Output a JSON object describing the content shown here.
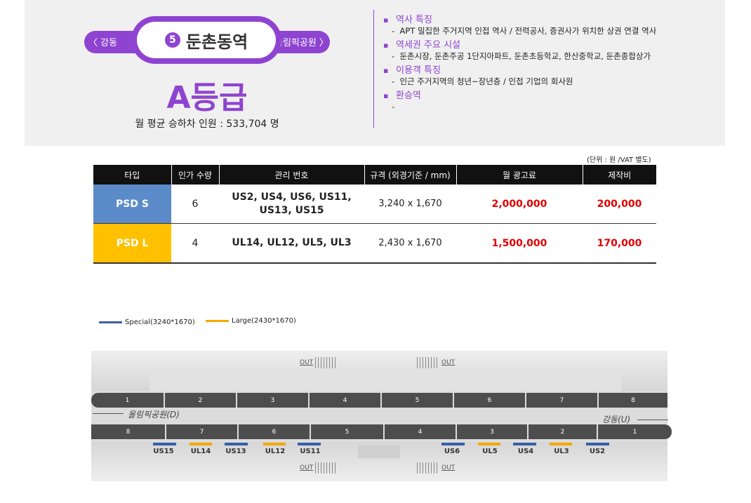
{
  "station": {
    "prev": "〈 강동",
    "next": "올림픽공원 〉",
    "number": "5",
    "name": "둔촌동역",
    "grade": "A등급",
    "ridership_label": "월 평균 승하차 인원 :",
    "ridership_value": "533,704 명"
  },
  "features": [
    {
      "title": "역사 특징",
      "desc": "APT  밀집한 주거지역 인접 역사 / 전력공사, 증권사가 위치한 상권 연결 역사"
    },
    {
      "title": "역세권 주요 시설",
      "desc": "둔촌시장,  둔촌주공 1단지아파트, 둔촌초등학교, 한산중학교, 둔촌종합상가"
    },
    {
      "title": "이용객 특징",
      "desc": "인근 주거지역의 청년~장년층 / 인접 기업의 회사원"
    },
    {
      "title": "환승역",
      "desc": ""
    }
  ],
  "bullet": "▪",
  "dash": "-",
  "table": {
    "unit": "(단위 : 원 /VAT 별도)",
    "headers": [
      "타입",
      "인가 수량",
      "관리 번호",
      "규격 (외경기준 / mm)",
      "월 광고료",
      "제작비"
    ],
    "rows": [
      {
        "type": "PSD S",
        "count": "6",
        "codes_1": "US2, US4, US6, US11,",
        "codes_2": "US13, US15",
        "spec": "3,240 x 1,670",
        "fee": "2,000,000",
        "production": "200,000",
        "color": "#5b8bc9"
      },
      {
        "type": "PSD L",
        "count": "4",
        "codes_1": "UL14, UL12, UL5, UL3",
        "codes_2": "",
        "spec": "2,430 x 1,670",
        "fee": "1,500,000",
        "production": "170,000",
        "color": "#ffc000"
      }
    ]
  },
  "legend": {
    "special": "Special(3240*1670)",
    "large": "Large(2430*1670)",
    "special_color": "#3a5fa8",
    "large_color": "#f5a800"
  },
  "map": {
    "top_cars": [
      "1",
      "2",
      "3",
      "4",
      "5",
      "6",
      "7",
      "8"
    ],
    "bottom_cars": [
      "8",
      "7",
      "6",
      "5",
      "4",
      "3",
      "2",
      "1"
    ],
    "dir_left": "올림픽공원(D)",
    "dir_right": "강동(U)",
    "exit_label": "OUT",
    "psds": [
      {
        "label": "US15",
        "kind": "S"
      },
      {
        "label": "UL14",
        "kind": "L"
      },
      {
        "label": "US13",
        "kind": "S"
      },
      {
        "label": "UL12",
        "kind": "L"
      },
      {
        "label": "US11",
        "kind": "S"
      },
      {
        "label": "US6",
        "kind": "S"
      },
      {
        "label": "UL5",
        "kind": "L"
      },
      {
        "label": "US4",
        "kind": "S"
      },
      {
        "label": "UL3",
        "kind": "L"
      },
      {
        "label": "US2",
        "kind": "S"
      }
    ]
  }
}
